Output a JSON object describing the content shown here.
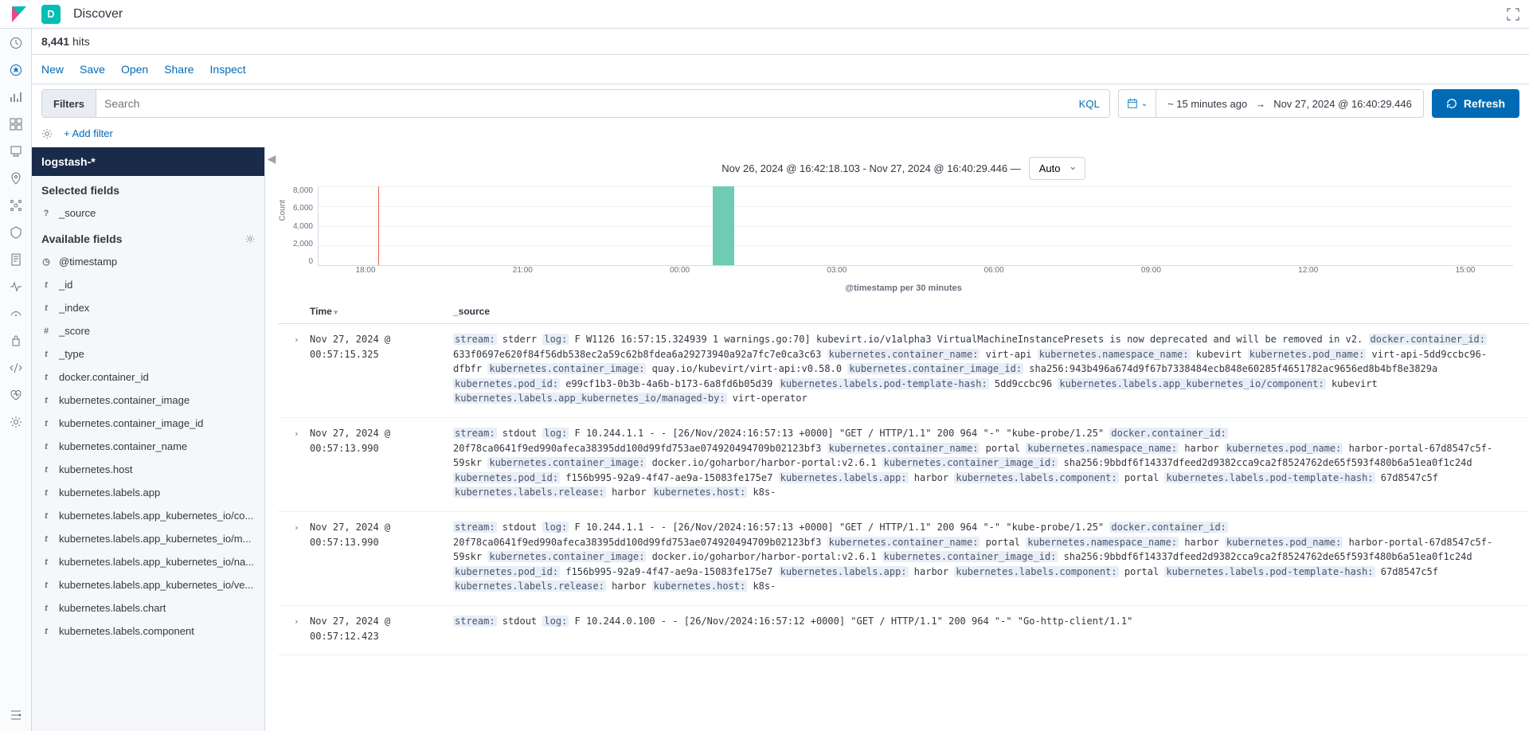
{
  "header": {
    "app_badge": "D",
    "app_title": "Discover"
  },
  "hits": {
    "count": "8,441",
    "suffix": "hits"
  },
  "toolbar": {
    "new": "New",
    "save": "Save",
    "open": "Open",
    "share": "Share",
    "inspect": "Inspect"
  },
  "search": {
    "filters_label": "Filters",
    "placeholder": "Search",
    "kql": "KQL",
    "time_from": "~ 15 minutes ago",
    "time_to": "Nov 27, 2024 @ 16:40:29.446",
    "refresh": "Refresh",
    "add_filter": "+ Add filter"
  },
  "sidebar": {
    "index_pattern": "logstash-*",
    "selected_label": "Selected fields",
    "available_label": "Available fields",
    "selected_fields": [
      {
        "type": "question",
        "name": "_source"
      }
    ],
    "available_fields": [
      {
        "type": "clock",
        "name": "@timestamp"
      },
      {
        "type": "t",
        "name": "_id"
      },
      {
        "type": "t",
        "name": "_index"
      },
      {
        "type": "hash",
        "name": "_score"
      },
      {
        "type": "t",
        "name": "_type"
      },
      {
        "type": "t",
        "name": "docker.container_id"
      },
      {
        "type": "t",
        "name": "kubernetes.container_image"
      },
      {
        "type": "t",
        "name": "kubernetes.container_image_id"
      },
      {
        "type": "t",
        "name": "kubernetes.container_name"
      },
      {
        "type": "t",
        "name": "kubernetes.host"
      },
      {
        "type": "t",
        "name": "kubernetes.labels.app"
      },
      {
        "type": "t",
        "name": "kubernetes.labels.app_kubernetes_io/co..."
      },
      {
        "type": "t",
        "name": "kubernetes.labels.app_kubernetes_io/m..."
      },
      {
        "type": "t",
        "name": "kubernetes.labels.app_kubernetes_io/na..."
      },
      {
        "type": "t",
        "name": "kubernetes.labels.app_kubernetes_io/ve..."
      },
      {
        "type": "t",
        "name": "kubernetes.labels.chart"
      },
      {
        "type": "t",
        "name": "kubernetes.labels.component"
      }
    ]
  },
  "histogram": {
    "range_label": "Nov 26, 2024 @ 16:42:18.103 - Nov 27, 2024 @ 16:40:29.446 —",
    "interval": "Auto",
    "y_label": "Count",
    "x_label": "@timestamp per 30 minutes"
  },
  "chart_data": {
    "type": "bar",
    "categories": [
      "18:00",
      "21:00",
      "00:00",
      "03:00",
      "06:00",
      "09:00",
      "12:00",
      "15:00"
    ],
    "values": [
      8441
    ],
    "bar_position_pct": 33,
    "cursor_pct": 5,
    "title": "",
    "xlabel": "@timestamp per 30 minutes",
    "ylabel": "Count",
    "ylim": [
      0,
      8000
    ],
    "y_ticks": [
      "8,000",
      "6,000",
      "4,000",
      "2,000",
      "0"
    ]
  },
  "table": {
    "col_time": "Time",
    "col_source": "_source",
    "rows": [
      {
        "time": "Nov 27, 2024 @ 00:57:15.325",
        "pairs": [
          [
            "stream:",
            "stderr"
          ],
          [
            "log:",
            "F W1126 16:57:15.324939 1 warnings.go:70] kubevirt.io/v1alpha3 VirtualMachineInstancePresets is now deprecated and will be removed in v2."
          ],
          [
            "docker.container_id:",
            "633f0697e620f84f56db538ec2a59c62b8fdea6a29273940a92a7fc7e0ca3c63"
          ],
          [
            "kubernetes.container_name:",
            "virt-api"
          ],
          [
            "kubernetes.namespace_name:",
            "kubevirt"
          ],
          [
            "kubernetes.pod_name:",
            "virt-api-5dd9ccbc96-dfbfr"
          ],
          [
            "kubernetes.container_image:",
            "quay.io/kubevirt/virt-api:v0.58.0"
          ],
          [
            "kubernetes.container_image_id:",
            "sha256:943b496a674d9f67b7338484ecb848e60285f4651782ac9656ed8b4bf8e3829a"
          ],
          [
            "kubernetes.pod_id:",
            "e99cf1b3-0b3b-4a6b-b173-6a8fd6b05d39"
          ],
          [
            "kubernetes.labels.pod-template-hash:",
            "5dd9ccbc96"
          ],
          [
            "kubernetes.labels.app_kubernetes_io/component:",
            "kubevirt"
          ],
          [
            "kubernetes.labels.app_kubernetes_io/managed-by:",
            "virt-operator"
          ]
        ]
      },
      {
        "time": "Nov 27, 2024 @ 00:57:13.990",
        "pairs": [
          [
            "stream:",
            "stdout"
          ],
          [
            "log:",
            "F 10.244.1.1 - - [26/Nov/2024:16:57:13 +0000] \"GET / HTTP/1.1\" 200 964 \"-\" \"kube-probe/1.25\""
          ],
          [
            "docker.container_id:",
            "20f78ca0641f9ed990afeca38395dd100d99fd753ae074920494709b02123bf3"
          ],
          [
            "kubernetes.container_name:",
            "portal"
          ],
          [
            "kubernetes.namespace_name:",
            "harbor"
          ],
          [
            "kubernetes.pod_name:",
            "harbor-portal-67d8547c5f-59skr"
          ],
          [
            "kubernetes.container_image:",
            "docker.io/goharbor/harbor-portal:v2.6.1"
          ],
          [
            "kubernetes.container_image_id:",
            "sha256:9bbdf6f14337dfeed2d9382cca9ca2f8524762de65f593f480b6a51ea0f1c24d"
          ],
          [
            "kubernetes.pod_id:",
            "f156b995-92a9-4f47-ae9a-15083fe175e7"
          ],
          [
            "kubernetes.labels.app:",
            "harbor"
          ],
          [
            "kubernetes.labels.component:",
            "portal"
          ],
          [
            "kubernetes.labels.pod-template-hash:",
            "67d8547c5f"
          ],
          [
            "kubernetes.labels.release:",
            "harbor"
          ],
          [
            "kubernetes.host:",
            "k8s-"
          ]
        ]
      },
      {
        "time": "Nov 27, 2024 @ 00:57:13.990",
        "pairs": [
          [
            "stream:",
            "stdout"
          ],
          [
            "log:",
            "F 10.244.1.1 - - [26/Nov/2024:16:57:13 +0000] \"GET / HTTP/1.1\" 200 964 \"-\" \"kube-probe/1.25\""
          ],
          [
            "docker.container_id:",
            "20f78ca0641f9ed990afeca38395dd100d99fd753ae074920494709b02123bf3"
          ],
          [
            "kubernetes.container_name:",
            "portal"
          ],
          [
            "kubernetes.namespace_name:",
            "harbor"
          ],
          [
            "kubernetes.pod_name:",
            "harbor-portal-67d8547c5f-59skr"
          ],
          [
            "kubernetes.container_image:",
            "docker.io/goharbor/harbor-portal:v2.6.1"
          ],
          [
            "kubernetes.container_image_id:",
            "sha256:9bbdf6f14337dfeed2d9382cca9ca2f8524762de65f593f480b6a51ea0f1c24d"
          ],
          [
            "kubernetes.pod_id:",
            "f156b995-92a9-4f47-ae9a-15083fe175e7"
          ],
          [
            "kubernetes.labels.app:",
            "harbor"
          ],
          [
            "kubernetes.labels.component:",
            "portal"
          ],
          [
            "kubernetes.labels.pod-template-hash:",
            "67d8547c5f"
          ],
          [
            "kubernetes.labels.release:",
            "harbor"
          ],
          [
            "kubernetes.host:",
            "k8s-"
          ]
        ]
      },
      {
        "time": "Nov 27, 2024 @ 00:57:12.423",
        "pairs": [
          [
            "stream:",
            "stdout"
          ],
          [
            "log:",
            "F 10.244.0.100 - - [26/Nov/2024:16:57:12 +0000] \"GET / HTTP/1.1\" 200 964 \"-\" \"Go-http-client/1.1\""
          ]
        ]
      }
    ]
  }
}
